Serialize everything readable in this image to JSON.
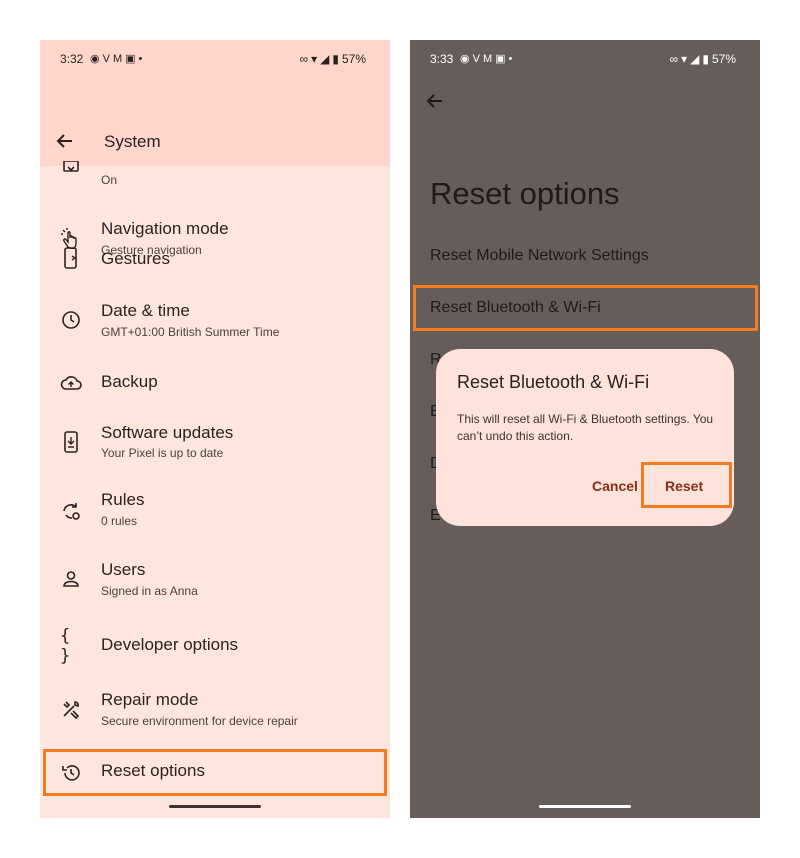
{
  "left_phone": {
    "status": {
      "time": "3:32",
      "notification_icons": [
        "messenger-icon",
        "v-app-icon",
        "gmail-icon",
        "teams-icon",
        "more-dot"
      ],
      "battery": "57%"
    },
    "appbar": {
      "title": "System"
    },
    "items": [
      {
        "label": "",
        "sub": "On",
        "icon": "keyboard-icon"
      },
      {
        "label": "Navigation mode",
        "sub": "Gesture navigation",
        "icon": "gesture-hand-icon"
      },
      {
        "label": "Gestures",
        "sub": "",
        "icon": "phone-gesture-icon"
      },
      {
        "label": "Date & time",
        "sub": "GMT+01:00 British Summer Time",
        "icon": "clock-icon"
      },
      {
        "label": "Backup",
        "sub": "",
        "icon": "cloud-upload-icon"
      },
      {
        "label": "Software updates",
        "sub": "Your Pixel is up to date",
        "icon": "system-update-icon"
      },
      {
        "label": "Rules",
        "sub": "0 rules",
        "icon": "rules-icon"
      },
      {
        "label": "Users",
        "sub": "Signed in as Anna",
        "icon": "person-icon"
      },
      {
        "label": "Developer options",
        "sub": "",
        "icon": "braces-icon"
      },
      {
        "label": "Repair mode",
        "sub": "Secure environment for device repair",
        "icon": "tools-icon"
      },
      {
        "label": "Reset options",
        "sub": "",
        "icon": "history-icon"
      }
    ],
    "braces_glyph": "{ }"
  },
  "right_phone": {
    "status": {
      "time": "3:33",
      "notification_icons": [
        "messenger-icon",
        "v-app-icon",
        "gmail-icon",
        "teams-icon",
        "more-dot"
      ],
      "battery": "57%"
    },
    "page_title": "Reset options",
    "options": [
      "Reset Mobile Network Settings",
      "Reset Bluetooth & Wi-Fi",
      "R",
      "E",
      "D",
      "E"
    ],
    "dialog": {
      "title": "Reset Bluetooth & Wi-Fi",
      "message": "This will reset all Wi-Fi & Bluetooth settings. You can’t undo this action.",
      "cancel": "Cancel",
      "confirm": "Reset"
    }
  },
  "colors": {
    "highlight": "#f47b20",
    "left_bg": "#ffe6dd",
    "left_bar": "#ffd6cc",
    "right_bg": "#665d5a",
    "dialog_bg": "#ffe2d9",
    "dialog_button": "#8b2d12"
  }
}
